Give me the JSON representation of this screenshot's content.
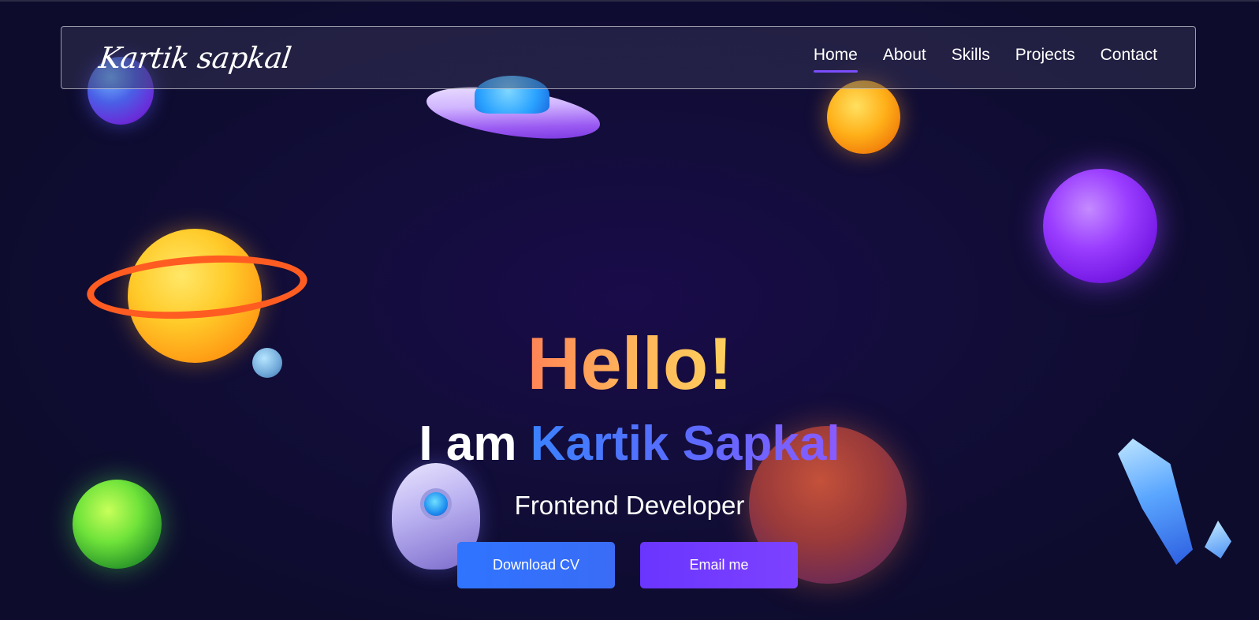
{
  "brand": {
    "logo_text": "Kartik sapkal"
  },
  "nav": {
    "items": [
      {
        "label": "Home",
        "active": true
      },
      {
        "label": "About",
        "active": false
      },
      {
        "label": "Skills",
        "active": false
      },
      {
        "label": "Projects",
        "active": false
      },
      {
        "label": "Contact",
        "active": false
      }
    ]
  },
  "hero": {
    "greeting": "Hello!",
    "intro_prefix": "I am ",
    "name": "Kartik Sapkal",
    "role": "Frontend Developer"
  },
  "buttons": {
    "download_cv": "Download CV",
    "email": "Email me"
  },
  "colors": {
    "accent": "#7b4dff",
    "primary_button": "#2f74ff",
    "secondary_button": "#7d42ff",
    "background": "#120d3a"
  },
  "decorations": [
    "blue-planet",
    "ufo",
    "gold-planet",
    "purple-planet",
    "ringed-planet",
    "green-planet",
    "rocket",
    "rock-planet",
    "crystal"
  ]
}
